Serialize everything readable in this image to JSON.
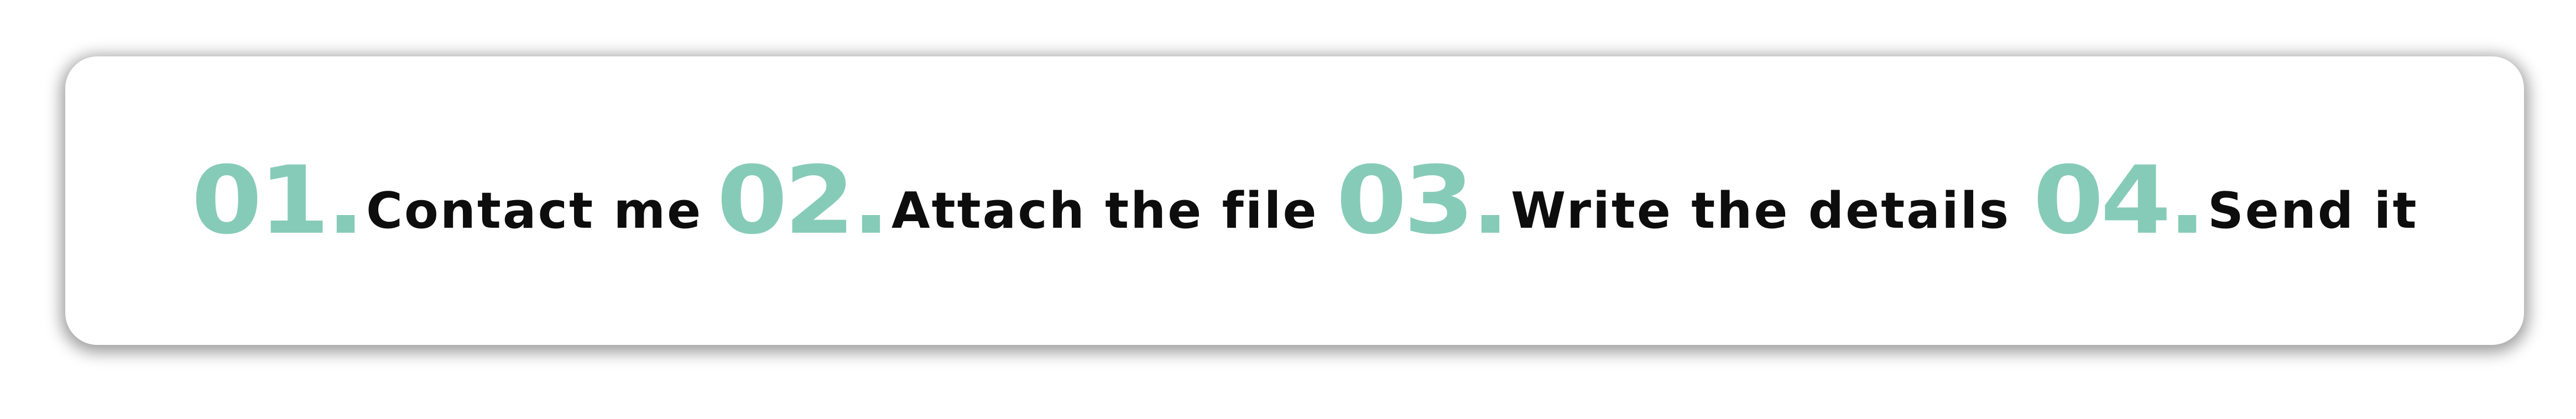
{
  "accent_color": "#86cbb8",
  "text_color": "#0d0d0d",
  "steps": [
    {
      "number": "01.",
      "label": "Contact me"
    },
    {
      "number": "02.",
      "label": "Attach the file"
    },
    {
      "number": "03.",
      "label": "Write the details"
    },
    {
      "number": "04.",
      "label": "Send it"
    }
  ]
}
